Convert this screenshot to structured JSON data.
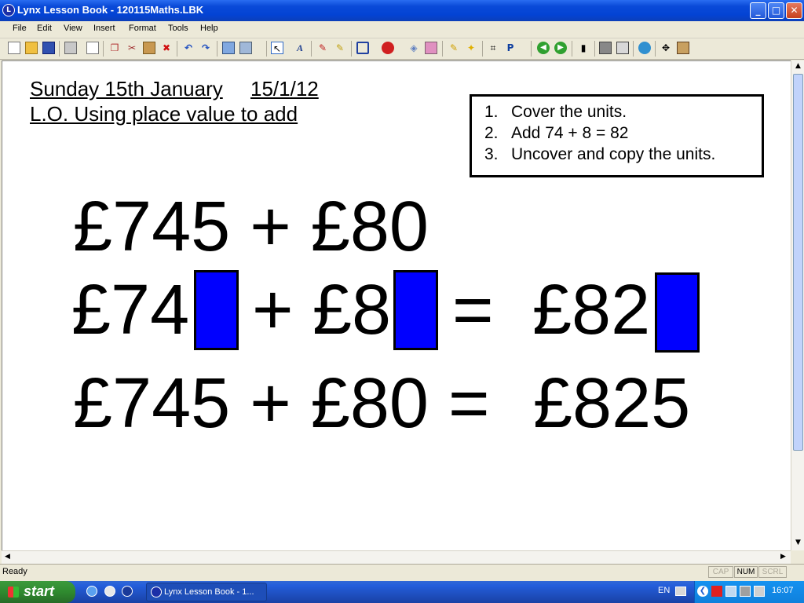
{
  "window": {
    "title": "Lynx Lesson Book - 120115Maths.LBK",
    "icon": "lynx-app-icon"
  },
  "menu": {
    "items": [
      "File",
      "Edit",
      "View",
      "Insert",
      "Format",
      "Tools",
      "Help"
    ]
  },
  "toolbar": {
    "icons": [
      "new-icon",
      "open-icon",
      "save-icon",
      "print-icon",
      "new-page-icon",
      "copy-icon",
      "cut-icon",
      "paste-icon",
      "delete-icon",
      "undo-icon",
      "redo-icon",
      "insert-image-icon",
      "image-options-icon",
      "pointer-icon",
      "text-icon",
      "pen-icon",
      "marker-icon",
      "shape-icon",
      "fill-icon",
      "paint-icon",
      "eraser-icon",
      "highlighter-icon",
      "spotlight-icon",
      "crop-icon",
      "format-painter-icon",
      "back-icon",
      "forward-icon",
      "reveal-icon",
      "keyboard-icon",
      "calculator-icon",
      "globe-icon",
      "move-icon",
      "tools-icon"
    ]
  },
  "page": {
    "date": "Sunday 15th January",
    "date_short": "15/1/12",
    "objective": "L.O. Using place value to add",
    "instructions": [
      {
        "num": "1.",
        "text": "Cover the units."
      },
      {
        "num": "2.",
        "text": "Add 74 + 8 = 82"
      },
      {
        "num": "3.",
        "text": "Uncover and copy the units."
      }
    ],
    "line1": "£745 + £80",
    "line2": {
      "a": "£74",
      "plus": "+",
      "b": "£8",
      "eq": "=",
      "c": "£82"
    },
    "line3": {
      "left": "£745 + £80 =",
      "right": "£825"
    },
    "cover_color": "#0000ff"
  },
  "status": {
    "text": "Ready",
    "indicators": [
      "CAP",
      "NUM",
      "SCRL"
    ]
  },
  "taskbar": {
    "start_label": "start",
    "task_label": "Lynx Lesson Book - 1...",
    "lang": "EN",
    "clock": "16:07"
  }
}
